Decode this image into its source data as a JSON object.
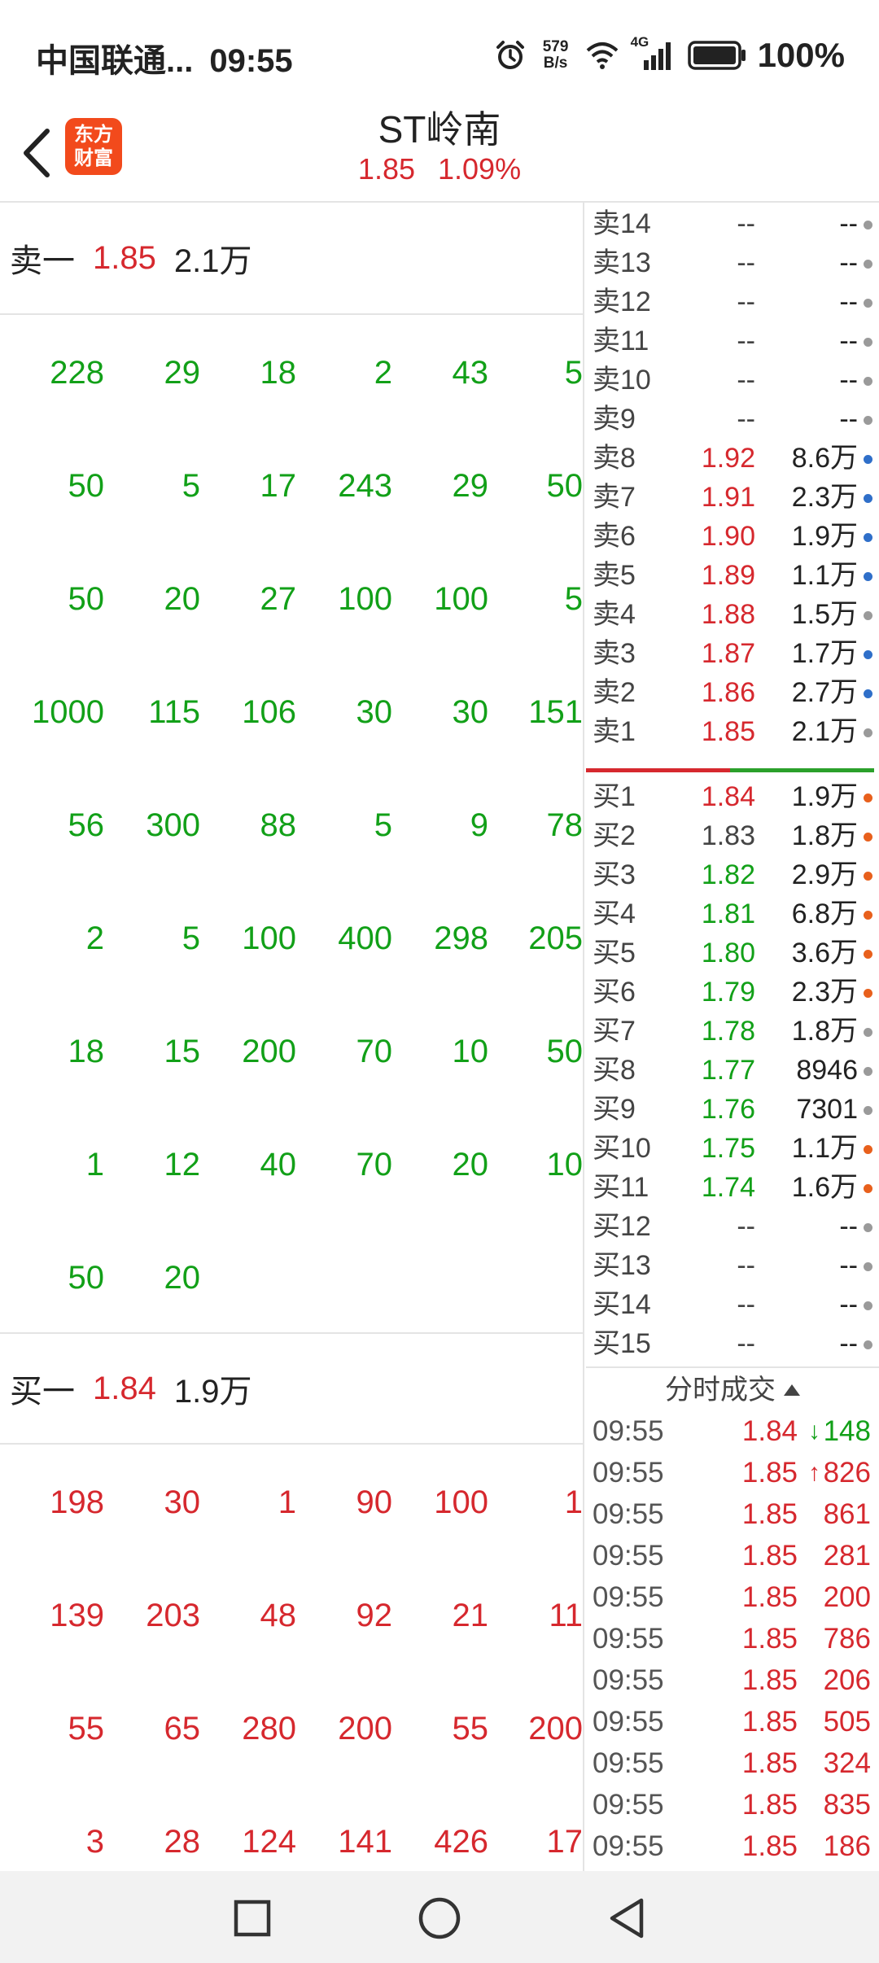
{
  "status": {
    "carrier": "中国联通...",
    "time": "09:55",
    "speed_value": "579",
    "speed_unit": "B/s",
    "network": "4G",
    "battery": "100%"
  },
  "header": {
    "logo_line1": "东方",
    "logo_line2": "财富",
    "title": "ST岭南",
    "price": "1.85",
    "change": "1.09%"
  },
  "colors": {
    "up": "#d6282e",
    "down": "#12a018",
    "dot_blue": "#2f6fc9",
    "dot_orange": "#e8601c",
    "dot_gray": "#9a9a9a"
  },
  "ask_summary": {
    "label": "卖一",
    "price": "1.85",
    "volume": "2.1万"
  },
  "ask_queue": [
    [
      "228",
      "29",
      "18",
      "2",
      "43",
      "5"
    ],
    [
      "50",
      "5",
      "17",
      "243",
      "29",
      "50"
    ],
    [
      "50",
      "20",
      "27",
      "100",
      "100",
      "5"
    ],
    [
      "1000",
      "115",
      "106",
      "30",
      "30",
      "151"
    ],
    [
      "56",
      "300",
      "88",
      "5",
      "9",
      "78"
    ],
    [
      "2",
      "5",
      "100",
      "400",
      "298",
      "205"
    ],
    [
      "18",
      "15",
      "200",
      "70",
      "10",
      "50"
    ],
    [
      "1",
      "12",
      "40",
      "70",
      "20",
      "10"
    ],
    [
      "50",
      "20"
    ]
  ],
  "bid_summary": {
    "label": "买一",
    "price": "1.84",
    "volume": "1.9万"
  },
  "bid_queue": [
    [
      "198",
      "30",
      "1",
      "90",
      "100",
      "1"
    ],
    [
      "139",
      "203",
      "48",
      "92",
      "21",
      "11"
    ],
    [
      "55",
      "65",
      "280",
      "200",
      "55",
      "200"
    ],
    [
      "3",
      "28",
      "124",
      "141",
      "426",
      "17"
    ]
  ],
  "asks": [
    {
      "label": "卖14",
      "price": "--",
      "volume": "--",
      "dot": "gray",
      "pc": "n"
    },
    {
      "label": "卖13",
      "price": "--",
      "volume": "--",
      "dot": "gray",
      "pc": "n"
    },
    {
      "label": "卖12",
      "price": "--",
      "volume": "--",
      "dot": "gray",
      "pc": "n"
    },
    {
      "label": "卖11",
      "price": "--",
      "volume": "--",
      "dot": "gray",
      "pc": "n"
    },
    {
      "label": "卖10",
      "price": "--",
      "volume": "--",
      "dot": "gray",
      "pc": "n"
    },
    {
      "label": "卖9",
      "price": "--",
      "volume": "--",
      "dot": "gray",
      "pc": "n"
    },
    {
      "label": "卖8",
      "price": "1.92",
      "volume": "8.6万",
      "dot": "blue",
      "pc": "r"
    },
    {
      "label": "卖7",
      "price": "1.91",
      "volume": "2.3万",
      "dot": "blue",
      "pc": "r"
    },
    {
      "label": "卖6",
      "price": "1.90",
      "volume": "1.9万",
      "dot": "blue",
      "pc": "r"
    },
    {
      "label": "卖5",
      "price": "1.89",
      "volume": "1.1万",
      "dot": "blue",
      "pc": "r"
    },
    {
      "label": "卖4",
      "price": "1.88",
      "volume": "1.5万",
      "dot": "gray",
      "pc": "r"
    },
    {
      "label": "卖3",
      "price": "1.87",
      "volume": "1.7万",
      "dot": "blue",
      "pc": "r"
    },
    {
      "label": "卖2",
      "price": "1.86",
      "volume": "2.7万",
      "dot": "blue",
      "pc": "r"
    },
    {
      "label": "卖1",
      "price": "1.85",
      "volume": "2.1万",
      "dot": "gray",
      "pc": "r"
    }
  ],
  "bids": [
    {
      "label": "买1",
      "price": "1.84",
      "volume": "1.9万",
      "dot": "orange",
      "pc": "r"
    },
    {
      "label": "买2",
      "price": "1.83",
      "volume": "1.8万",
      "dot": "orange",
      "pc": "n"
    },
    {
      "label": "买3",
      "price": "1.82",
      "volume": "2.9万",
      "dot": "orange",
      "pc": "g"
    },
    {
      "label": "买4",
      "price": "1.81",
      "volume": "6.8万",
      "dot": "orange",
      "pc": "g"
    },
    {
      "label": "买5",
      "price": "1.80",
      "volume": "3.6万",
      "dot": "orange",
      "pc": "g"
    },
    {
      "label": "买6",
      "price": "1.79",
      "volume": "2.3万",
      "dot": "orange",
      "pc": "g"
    },
    {
      "label": "买7",
      "price": "1.78",
      "volume": "1.8万",
      "dot": "gray",
      "pc": "g"
    },
    {
      "label": "买8",
      "price": "1.77",
      "volume": "8946",
      "dot": "gray",
      "pc": "g"
    },
    {
      "label": "买9",
      "price": "1.76",
      "volume": "7301",
      "dot": "gray",
      "pc": "g"
    },
    {
      "label": "买10",
      "price": "1.75",
      "volume": "1.1万",
      "dot": "orange",
      "pc": "g"
    },
    {
      "label": "买11",
      "price": "1.74",
      "volume": "1.6万",
      "dot": "orange",
      "pc": "g"
    },
    {
      "label": "买12",
      "price": "--",
      "volume": "--",
      "dot": "gray",
      "pc": "n"
    },
    {
      "label": "买13",
      "price": "--",
      "volume": "--",
      "dot": "gray",
      "pc": "n"
    },
    {
      "label": "买14",
      "price": "--",
      "volume": "--",
      "dot": "gray",
      "pc": "n"
    },
    {
      "label": "买15",
      "price": "--",
      "volume": "--",
      "dot": "gray",
      "pc": "n"
    }
  ],
  "ticks_title": "分时成交",
  "ticks": [
    {
      "time": "09:55",
      "price": "1.84",
      "arrow": "↓",
      "dir": "down",
      "vol": "148"
    },
    {
      "time": "09:55",
      "price": "1.85",
      "arrow": "↑",
      "dir": "up",
      "vol": "826"
    },
    {
      "time": "09:55",
      "price": "1.85",
      "arrow": "",
      "dir": "up",
      "vol": "861"
    },
    {
      "time": "09:55",
      "price": "1.85",
      "arrow": "",
      "dir": "up",
      "vol": "281"
    },
    {
      "time": "09:55",
      "price": "1.85",
      "arrow": "",
      "dir": "up",
      "vol": "200"
    },
    {
      "time": "09:55",
      "price": "1.85",
      "arrow": "",
      "dir": "up",
      "vol": "786"
    },
    {
      "time": "09:55",
      "price": "1.85",
      "arrow": "",
      "dir": "up",
      "vol": "206"
    },
    {
      "time": "09:55",
      "price": "1.85",
      "arrow": "",
      "dir": "up",
      "vol": "505"
    },
    {
      "time": "09:55",
      "price": "1.85",
      "arrow": "",
      "dir": "up",
      "vol": "324"
    },
    {
      "time": "09:55",
      "price": "1.85",
      "arrow": "",
      "dir": "up",
      "vol": "835"
    },
    {
      "time": "09:55",
      "price": "1.85",
      "arrow": "",
      "dir": "up",
      "vol": "186"
    }
  ]
}
